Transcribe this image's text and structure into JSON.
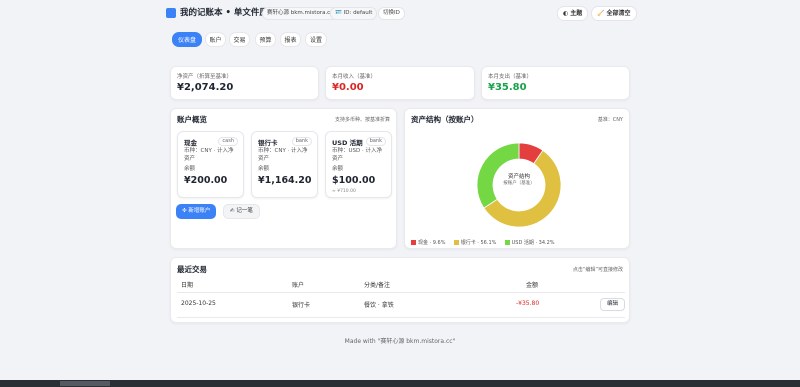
{
  "header": {
    "title": "我的记账本 • 单文件原型",
    "watermark_pill": "赛轩心源 bkm.mistora.cc",
    "id_pill": "ID: default",
    "switch_id": "切换ID",
    "theme_button": "主题",
    "clear_button": "全部清空"
  },
  "tabs": [
    "仪表盘",
    "账户",
    "交易",
    "预算",
    "报表",
    "设置"
  ],
  "stats": [
    {
      "label": "净资产（折算至基准）",
      "value": "¥2,074.20",
      "color": "#1f2530"
    },
    {
      "label": "本月收入（基准）",
      "value": "¥0.00",
      "color": "#dc2626"
    },
    {
      "label": "本月支出（基准）",
      "value": "¥35.80",
      "color": "#16a34a"
    }
  ],
  "accounts_panel": {
    "title": "账户概览",
    "hint": "支持多币种、按基准折算",
    "accounts": [
      {
        "name": "现金",
        "tag": "cash",
        "meta1": "币种：CNY · 计入净",
        "meta2": "资产",
        "meta3": "余额",
        "balance": "¥200.00",
        "sub": ""
      },
      {
        "name": "银行卡",
        "tag": "bank",
        "meta1": "币种：CNY · 计入净",
        "meta2": "资产",
        "meta3": "余额",
        "balance": "¥1,164.20",
        "sub": ""
      },
      {
        "name": "USD 活期",
        "tag": "bank",
        "meta1": "币种：USD · 计入净",
        "meta2": "资产",
        "meta3": "余额",
        "balance": "$100.00",
        "sub": "≈ ¥710.00"
      }
    ],
    "new_account_button": "新增账户",
    "record_button": "记一笔"
  },
  "asset_panel": {
    "title": "资产结构（按账户）",
    "base_label": "基准：CNY",
    "center_title": "资产结构",
    "center_sub": "按账户（基准）",
    "legend": [
      {
        "label": "现金 · 9.6%",
        "color": "#e53e3e",
        "value": 9.6
      },
      {
        "label": "银行卡 · 56.1%",
        "color": "#e0c040",
        "value": 56.1
      },
      {
        "label": "USD 活期 · 34.2%",
        "color": "#74d744",
        "value": 34.2
      }
    ]
  },
  "transactions": {
    "title": "最近交易",
    "hint": "点击“编辑”可直接修改",
    "columns": [
      "日期",
      "账户",
      "分类/备注",
      "金额"
    ],
    "rows": [
      {
        "date": "2025-10-25",
        "account": "银行卡",
        "category": "餐饮 · 拿铁",
        "amount": "-¥35.80",
        "edit": "编辑"
      }
    ]
  },
  "footer": "Made with \"赛轩心源 bkm.mistora.cc\""
}
